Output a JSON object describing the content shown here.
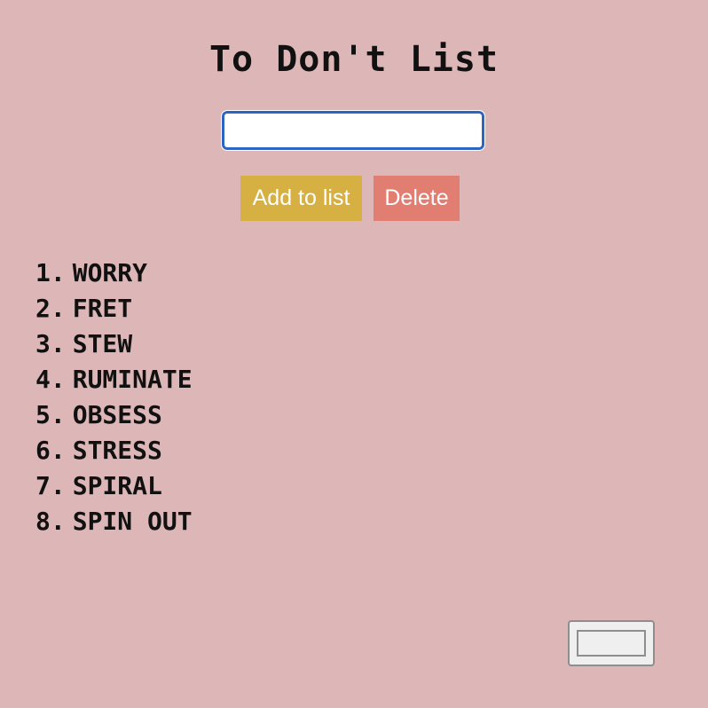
{
  "title": "To Don't List",
  "input": {
    "value": "",
    "placeholder": ""
  },
  "buttons": {
    "add_label": "Add to list",
    "delete_label": "Delete"
  },
  "colors": {
    "background": "#ddb6b7",
    "add_button": "#d6b042",
    "delete_button": "#e27d71",
    "input_border": "#2d66c2",
    "text": "#111111"
  },
  "items": [
    {
      "number": "1.",
      "text": "WORRY"
    },
    {
      "number": "2.",
      "text": "FRET"
    },
    {
      "number": "3.",
      "text": "STEW"
    },
    {
      "number": "4.",
      "text": "RUMINATE"
    },
    {
      "number": "5.",
      "text": "OBSESS"
    },
    {
      "number": "6.",
      "text": "STRESS"
    },
    {
      "number": "7.",
      "text": "SPIRAL"
    },
    {
      "number": "8.",
      "text": "SPIN OUT"
    }
  ]
}
